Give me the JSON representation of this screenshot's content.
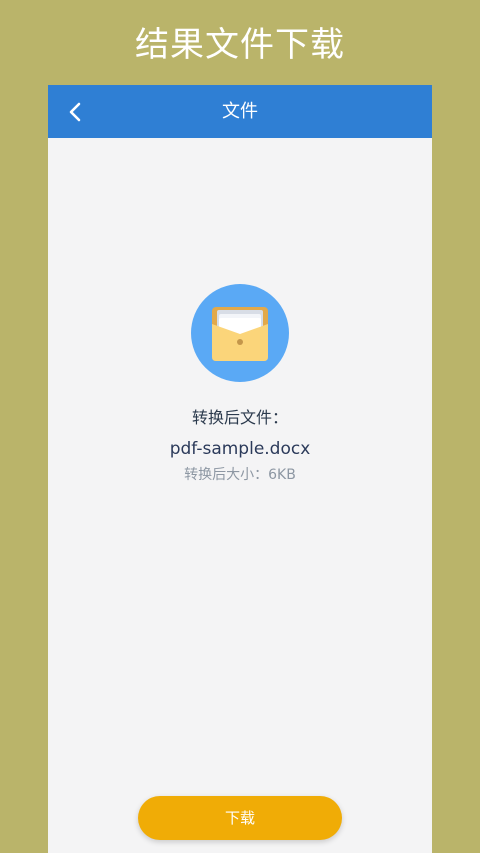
{
  "promo": {
    "title": "结果文件下载"
  },
  "nav": {
    "title": "文件",
    "back_icon": "chevron-left-icon",
    "background": "#2f7fd4"
  },
  "file": {
    "icon": "folder-envelope-icon",
    "converted_label": "转换后文件：",
    "name": "pdf-sample.docx",
    "size_text": "转换后大小：6KB"
  },
  "actions": {
    "download_label": "下载",
    "download_color": "#f0ac06"
  },
  "colors": {
    "page_background": "#bab46a",
    "content_background": "#f4f4f5",
    "icon_circle": "#5aa9f5",
    "folder": "#fbd57a"
  }
}
